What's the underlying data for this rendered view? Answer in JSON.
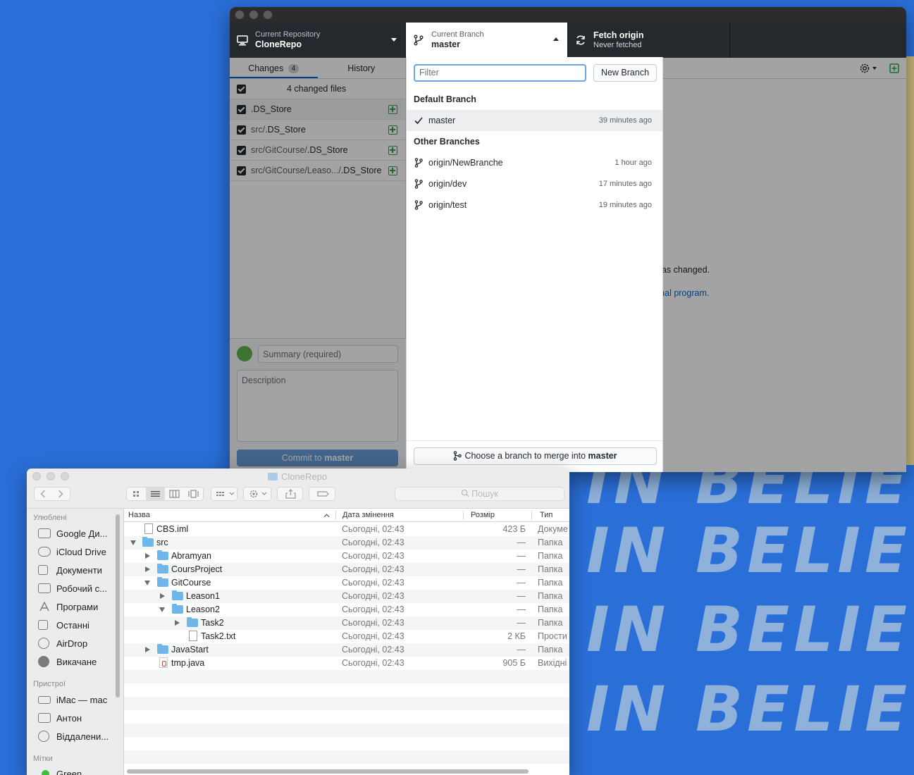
{
  "wallpaper": {
    "lines": [
      "IN BELIEV",
      "IN BELIEV",
      "IN BELIEV",
      "IN BELIEV"
    ]
  },
  "github": {
    "toolbar": {
      "repo_label": "Current Repository",
      "repo_value": "CloneRepo",
      "branch_label": "Current Branch",
      "branch_value": "master",
      "fetch_label": "Fetch origin",
      "fetch_sub": "Never fetched"
    },
    "tabs": {
      "changes": "Changes",
      "changes_count": "4",
      "history": "History"
    },
    "changes_header": "4 changed files",
    "files": [
      {
        "dir": "",
        "name": ".DS_Store"
      },
      {
        "dir": "src/",
        "name": ".DS_Store"
      },
      {
        "dir": "src/GitCourse/",
        "name": ".DS_Store"
      },
      {
        "dir": "src/GitCourse/Leaso.../",
        "name": ".DS_Store"
      }
    ],
    "summary_placeholder": "Summary (required)",
    "description_placeholder": "Description",
    "commit_prefix": "Commit to ",
    "commit_branch": "master",
    "background_text_1": "has changed.",
    "background_text_2": "rnal program.",
    "branch_dropdown": {
      "filter_placeholder": "Filter",
      "new_branch": "New Branch",
      "default_heading": "Default Branch",
      "other_heading": "Other Branches",
      "default_branch": {
        "name": "master",
        "time": "39 minutes ago"
      },
      "other_branches": [
        {
          "name": "origin/NewBranche",
          "time": "1 hour ago"
        },
        {
          "name": "origin/dev",
          "time": "17 minutes ago"
        },
        {
          "name": "origin/test",
          "time": "19 minutes ago"
        }
      ],
      "merge_prefix": "Choose a branch to merge into ",
      "merge_branch": "master"
    }
  },
  "finder": {
    "title": "CloneRepo",
    "search_placeholder": "Пошук",
    "sidebar": {
      "favorites_heading": "Улюблені",
      "favorites": [
        "Google Ди...",
        "iCloud Drive",
        "Документи",
        "Робочий с...",
        "Програми",
        "Останні",
        "AirDrop",
        "Викачане"
      ],
      "devices_heading": "Пристрої",
      "devices": [
        "iMac — mac",
        "Антон",
        "Віддалени..."
      ],
      "tags_heading": "Мітки",
      "tags": [
        "Green"
      ]
    },
    "columns": {
      "name": "Назва",
      "date": "Дата змінення",
      "size": "Розмір",
      "kind": "Тип"
    },
    "rows": [
      {
        "name": "CBS.iml",
        "date": "Сьогодні, 02:43",
        "size": "423 Б",
        "kind": "Докуме"
      },
      {
        "name": "src",
        "date": "Сьогодні, 02:43",
        "size": "—",
        "kind": "Папка"
      },
      {
        "name": "Abramyan",
        "date": "Сьогодні, 02:43",
        "size": "—",
        "kind": "Папка"
      },
      {
        "name": "CoursProject",
        "date": "Сьогодні, 02:43",
        "size": "—",
        "kind": "Папка"
      },
      {
        "name": "GitCourse",
        "date": "Сьогодні, 02:43",
        "size": "—",
        "kind": "Папка"
      },
      {
        "name": "Leason1",
        "date": "Сьогодні, 02:43",
        "size": "—",
        "kind": "Папка"
      },
      {
        "name": "Leason2",
        "date": "Сьогодні, 02:43",
        "size": "—",
        "kind": "Папка"
      },
      {
        "name": "Task2",
        "date": "Сьогодні, 02:43",
        "size": "—",
        "kind": "Папка"
      },
      {
        "name": "Task2.txt",
        "date": "Сьогодні, 02:43",
        "size": "2 КБ",
        "kind": "Прости"
      },
      {
        "name": "JavaStart",
        "date": "Сьогодні, 02:43",
        "size": "—",
        "kind": "Папка"
      },
      {
        "name": "tmp.java",
        "date": "Сьогодні, 02:43",
        "size": "905 Б",
        "kind": "Вихідні"
      }
    ]
  }
}
